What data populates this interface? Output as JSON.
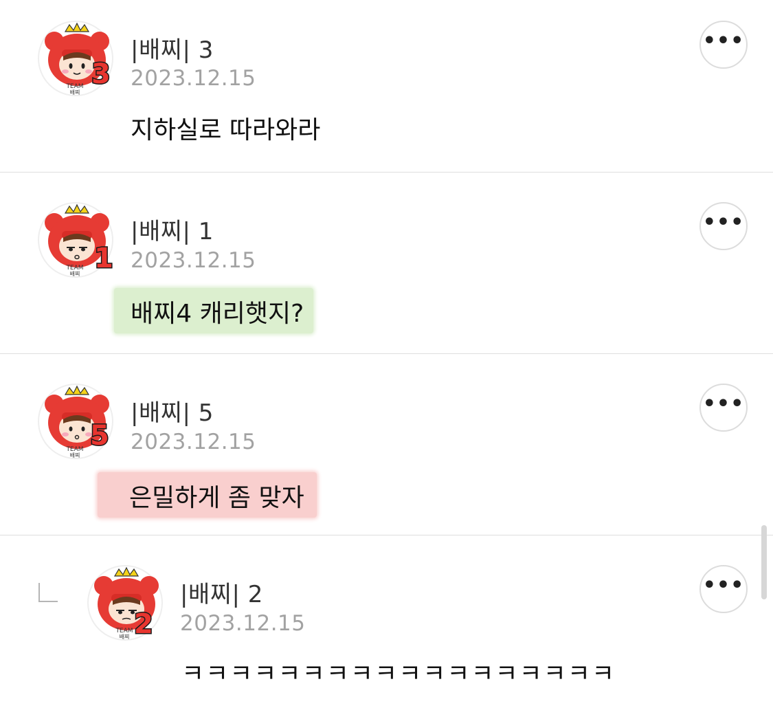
{
  "comments": [
    {
      "author": "|배찌| 3",
      "date": "2023.12.15",
      "text": "지하실로 따라와라",
      "badge": "3",
      "highlight": "none"
    },
    {
      "author": "|배찌| 1",
      "date": "2023.12.15",
      "text": "배찌4 캐리햇지?",
      "badge": "1",
      "highlight": "#dcefcf"
    },
    {
      "author": "|배찌| 5",
      "date": "2023.12.15",
      "text": "은밀하게 좀 맞자",
      "badge": "5",
      "highlight": "#f9cfce"
    },
    {
      "author": "|배찌| 2",
      "date": "2023.12.15",
      "text": "ㅋㅋㅋㅋㅋㅋㅋㅋㅋㅋㅋㅋㅋㅋㅋㅋㅋㅋ",
      "badge": "2",
      "highlight": "none",
      "is_reply": true
    }
  ],
  "avatar_caption": "TEAM 배찌",
  "more_icon": "more-horizontal-icon",
  "more_label": "•••",
  "reply_icon": "reply-corner-icon"
}
